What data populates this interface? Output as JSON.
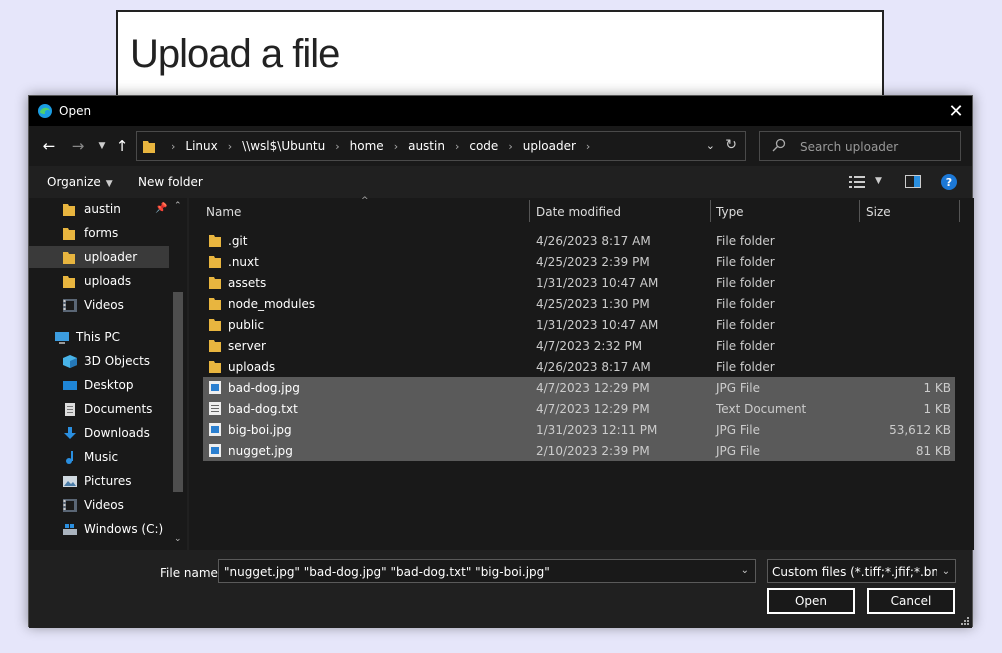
{
  "page": {
    "title": "Upload a file"
  },
  "dialog": {
    "title": "Open",
    "address_crumbs": [
      "Linux",
      "\\\\wsl$\\Ubuntu",
      "home",
      "austin",
      "code",
      "uploader"
    ],
    "search_placeholder": "Search uploader",
    "toolbar": {
      "organize": "Organize",
      "new_folder": "New folder"
    },
    "sidebar": [
      {
        "label": "austin",
        "icon": "folder-icon",
        "pinned": true
      },
      {
        "label": "forms",
        "icon": "folder-icon"
      },
      {
        "label": "uploader",
        "icon": "folder-icon",
        "selected": true
      },
      {
        "label": "uploads",
        "icon": "folder-icon"
      },
      {
        "label": "Videos",
        "icon": "videos-icon"
      },
      {
        "label": "This PC",
        "icon": "computer-icon"
      },
      {
        "label": "3D Objects",
        "icon": "3d-objects-icon"
      },
      {
        "label": "Desktop",
        "icon": "desktop-icon"
      },
      {
        "label": "Documents",
        "icon": "documents-icon"
      },
      {
        "label": "Downloads",
        "icon": "downloads-icon"
      },
      {
        "label": "Music",
        "icon": "music-icon"
      },
      {
        "label": "Pictures",
        "icon": "pictures-icon"
      },
      {
        "label": "Videos",
        "icon": "videos-icon"
      },
      {
        "label": "Windows (C:)",
        "icon": "drive-icon"
      }
    ],
    "columns": {
      "name": "Name",
      "date": "Date modified",
      "type": "Type",
      "size": "Size"
    },
    "files": [
      {
        "name": ".git",
        "date": "4/26/2023 8:17 AM",
        "type": "File folder",
        "size": "",
        "icon": "folder-icon"
      },
      {
        "name": ".nuxt",
        "date": "4/25/2023 2:39 PM",
        "type": "File folder",
        "size": "",
        "icon": "folder-icon"
      },
      {
        "name": "assets",
        "date": "1/31/2023 10:47 AM",
        "type": "File folder",
        "size": "",
        "icon": "folder-icon"
      },
      {
        "name": "node_modules",
        "date": "4/25/2023 1:30 PM",
        "type": "File folder",
        "size": "",
        "icon": "folder-icon"
      },
      {
        "name": "public",
        "date": "1/31/2023 10:47 AM",
        "type": "File folder",
        "size": "",
        "icon": "folder-icon"
      },
      {
        "name": "server",
        "date": "4/7/2023 2:32 PM",
        "type": "File folder",
        "size": "",
        "icon": "folder-icon"
      },
      {
        "name": "uploads",
        "date": "4/26/2023 8:17 AM",
        "type": "File folder",
        "size": "",
        "icon": "folder-icon"
      },
      {
        "name": "bad-dog.jpg",
        "date": "4/7/2023 12:29 PM",
        "type": "JPG File",
        "size": "1 KB",
        "icon": "image-file-icon",
        "selected": true
      },
      {
        "name": "bad-dog.txt",
        "date": "4/7/2023 12:29 PM",
        "type": "Text Document",
        "size": "1 KB",
        "icon": "text-file-icon",
        "selected": true
      },
      {
        "name": "big-boi.jpg",
        "date": "1/31/2023 12:11 PM",
        "type": "JPG File",
        "size": "53,612 KB",
        "icon": "image-file-icon",
        "selected": true
      },
      {
        "name": "nugget.jpg",
        "date": "2/10/2023 2:39 PM",
        "type": "JPG File",
        "size": "81 KB",
        "icon": "image-file-icon",
        "selected": true
      }
    ],
    "file_name_label": "File name:",
    "file_name_value": "\"nugget.jpg\" \"bad-dog.jpg\" \"bad-dog.txt\" \"big-boi.jpg\"",
    "file_type_filter": "Custom files (*.tiff;*.jfif;*.bmp;*",
    "open_label": "Open",
    "cancel_label": "Cancel"
  }
}
